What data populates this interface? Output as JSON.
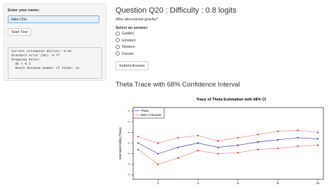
{
  "sidebar": {
    "name_label": "Enter your name:",
    "name_value": "Jake Cho",
    "start_label": "Start Test",
    "stats": [
      "Current estimated ability: 0.64",
      "Standard error (SE): 0.77",
      "Stopping Rules:",
      "  SE < 0.1",
      "  Reach Maximum Number of Items: 31"
    ]
  },
  "question": {
    "title": "Question Q20 : Difficulty : 0.8 logits",
    "text": "Who discovered gravity?",
    "answer_label": "Select an answer:",
    "options": [
      "Galileo",
      "Einstein",
      "Newton",
      "Darwin"
    ],
    "submit_label": "Submit Answer"
  },
  "section_title": "Theta Trace with 68% Confidence Interval",
  "colors": {
    "theta": "#3333cc",
    "ci": "#dd2222"
  },
  "chart_data": {
    "type": "line",
    "title": "Trace of Theta Estimation with 68% CI",
    "xlabel": "",
    "ylabel": "Estimated Ability (Theta)",
    "xlim": [
      1,
      10
    ],
    "ylim": [
      -3,
      3
    ],
    "x_ticks": [
      2,
      4,
      6,
      8,
      10
    ],
    "y_ticks": [
      -3,
      -2,
      -1,
      0,
      1,
      2,
      3
    ],
    "legend_position": "top-left",
    "x": [
      1,
      2,
      3,
      4,
      5,
      6,
      7,
      8,
      9,
      10
    ],
    "series": [
      {
        "name": "Theta",
        "values": [
          0.0,
          -1.0,
          -0.4,
          0.0,
          -0.4,
          -0.2,
          0.1,
          0.3,
          0.5,
          0.4
        ]
      },
      {
        "name": "68% CI bounds",
        "values": [
          0.6,
          0.0,
          0.5,
          0.7,
          0.2,
          0.5,
          0.8,
          1.1,
          1.2,
          1.0
        ]
      },
      {
        "name": "",
        "values": [
          -0.6,
          -2.0,
          -1.4,
          -0.7,
          -1.0,
          -0.9,
          -0.6,
          -0.5,
          -0.3,
          -0.2
        ]
      }
    ]
  }
}
